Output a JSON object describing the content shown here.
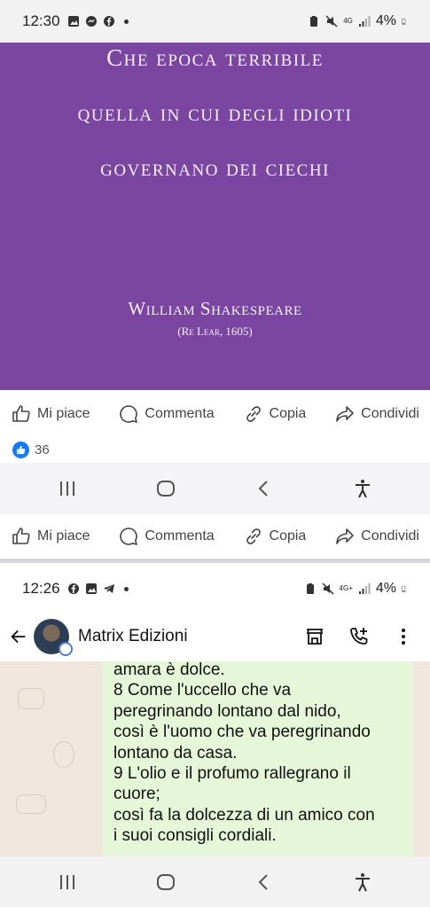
{
  "status_top": {
    "time": "12:30",
    "battery": "4%",
    "network": "4G"
  },
  "post": {
    "quote_lines": [
      "Che epoca terribile",
      "quella in cui degli idioti",
      "governano dei ciechi"
    ],
    "author": "William Shakespeare",
    "work": "(Re Lear, 1605)",
    "background_color": "#7a46a0"
  },
  "actions": {
    "like": "Mi piace",
    "comment": "Commenta",
    "copy": "Copia",
    "share": "Condividi"
  },
  "reactions": {
    "count": "36"
  },
  "status_bottom": {
    "time": "12:26",
    "battery": "4%",
    "network": "4G+"
  },
  "chat": {
    "contact_name": "Matrix Edizioni",
    "message_lines": [
      "amara è dolce.",
      "8  Come l'uccello che va",
      "peregrinando lontano dal nido,",
      "così è l'uomo che va peregrinando",
      "lontano da casa.",
      "9  L'olio e il profumo rallegrano il",
      "cuore;",
      "così fa la dolcezza di un amico con",
      "i suoi consigli cordiali."
    ]
  },
  "icons": [
    "gallery-icon",
    "messenger-icon",
    "facebook-icon",
    "telegram-icon",
    "mute-icon",
    "signal-icon",
    "battery-icon",
    "like-icon",
    "comment-icon",
    "copy-icon",
    "share-icon",
    "recents-icon",
    "home-icon",
    "back-icon",
    "accessibility-icon",
    "store-icon",
    "add-call-icon",
    "more-icon",
    "arrow-back-icon"
  ]
}
